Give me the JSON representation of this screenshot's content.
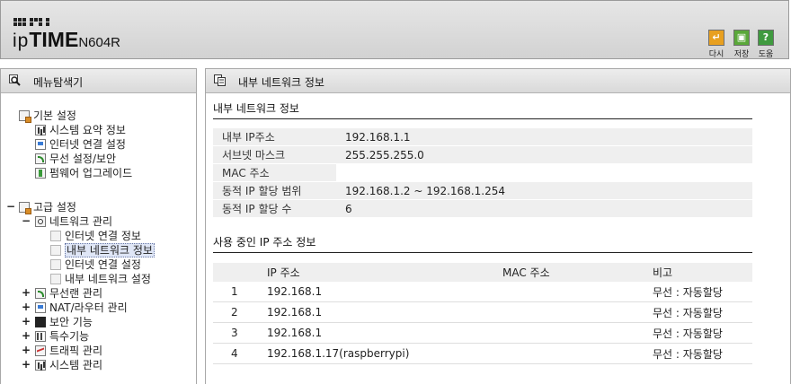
{
  "brand": {
    "logo_text": "ipTIME",
    "model": "N604R"
  },
  "toolbar": {
    "buttons": [
      {
        "label": "다시",
        "icon": "refresh-icon",
        "color": "#e8a020"
      },
      {
        "label": "저장",
        "icon": "save-icon",
        "color": "#5aa83a"
      },
      {
        "label": "도움",
        "icon": "help-icon",
        "glyph": "?",
        "color": "#3f9a3f"
      }
    ]
  },
  "sidebar": {
    "title": "메뉴탐색기",
    "basic": {
      "label": "기본 설정",
      "items": [
        "시스템 요약 정보",
        "인터넷 연결 설정",
        "무선 설정/보안",
        "펌웨어 업그레이드"
      ]
    },
    "advanced": {
      "label": "고급 설정",
      "network": {
        "label": "네트워크 관리",
        "items": [
          "인터넷 연결 정보",
          "내부 네트워크 정보",
          "인터넷 연결 설정",
          "내부 네트워크 설정"
        ],
        "selected_index": 1
      },
      "groups": [
        "무선랜 관리",
        "NAT/라우터 관리",
        "보안 기능",
        "특수기능",
        "트래픽 관리",
        "시스템 관리"
      ]
    }
  },
  "main": {
    "title": "내부 네트워크 정보",
    "section1": "내부 네트워크 정보",
    "info": [
      {
        "key": "내부 IP주소",
        "value": "192.168.1.1"
      },
      {
        "key": "서브넷 마스크",
        "value": "255.255.255.0"
      },
      {
        "key": "MAC 주소",
        "value": ""
      },
      {
        "key": "동적 IP 할당 범위",
        "value": "192.168.1.2 ~  192.168.1.254"
      },
      {
        "key": "동적 IP 할당 수",
        "value": "6"
      }
    ],
    "section2": "사용 중인 IP 주소 정보",
    "ip_table": {
      "headers": [
        "IP 주소",
        "MAC 주소",
        "비고"
      ],
      "rows": [
        {
          "no": "1",
          "ip": "192.168.1",
          "mac": "",
          "note": "무선 : 자동할당"
        },
        {
          "no": "2",
          "ip": "192.168.1",
          "mac": "",
          "note": "무선 : 자동할당"
        },
        {
          "no": "3",
          "ip": "192.168.1",
          "mac": "",
          "note": "무선 : 자동할당"
        },
        {
          "no": "4",
          "ip": "192.168.1.17(raspberrypi)",
          "mac": "",
          "note": "무선 : 자동할당"
        }
      ]
    }
  }
}
